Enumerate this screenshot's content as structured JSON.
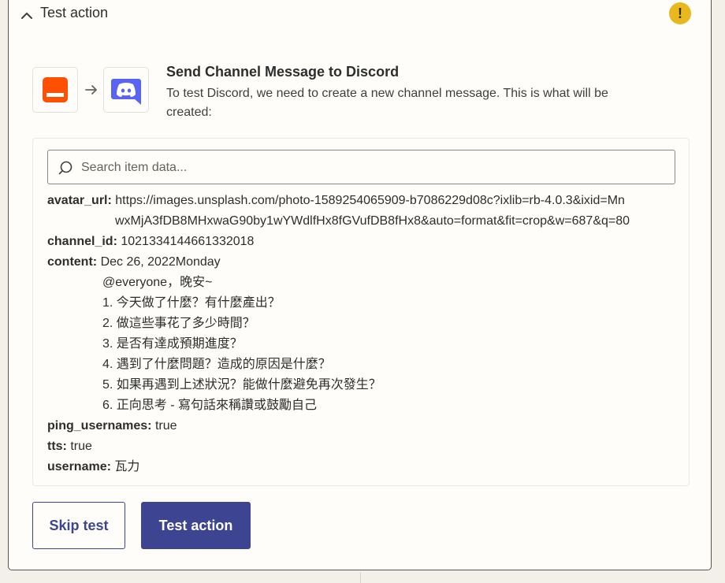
{
  "header": {
    "title": "Test action",
    "warning_symbol": "!",
    "warning_color": "#e8b81e"
  },
  "step": {
    "source_icon": "app-logo-icon",
    "target_icon": "discord-icon",
    "title": "Send Channel Message to Discord",
    "description": "To test Discord, we need to create a new channel message. This is what will be created:"
  },
  "search": {
    "placeholder": "Search item data...",
    "value": ""
  },
  "fields": {
    "avatar_url": {
      "key": "avatar_url:",
      "line1": "https://images.unsplash.com/photo-1589254065909-b7086229d08c?ixlib=rb-4.0.3&ixid=Mn",
      "line2": "wxMjA3fDB8MHxwaG90by1wYWdlfHx8fGVufDB8fHx8&auto=format&fit=crop&w=687&q=80"
    },
    "channel_id": {
      "key": "channel_id:",
      "value": "1021334144661332018"
    },
    "content": {
      "key": "content:",
      "lines": [
        "Dec 26, 2022Monday",
        "@everyone，晚安~",
        "1. 今天做了什麼？有什麼產出？",
        "2. 做這些事花了多少時間？",
        "3. 是否有達成預期進度？",
        "4. 遇到了什麼問題？造成的原因是什麼？",
        "5. 如果再遇到上述狀況？能做什麼避免再次發生？",
        "6. 正向思考 - 寫句話來稱讚或鼓勵自己"
      ]
    },
    "ping_usernames": {
      "key": "ping_usernames:",
      "value": "true"
    },
    "tts": {
      "key": "tts:",
      "value": "true"
    },
    "username": {
      "key": "username:",
      "value": "瓦力"
    }
  },
  "buttons": {
    "skip": "Skip test",
    "test": "Test action"
  },
  "colors": {
    "primary": "#3d4592",
    "source_app": "#ff4f00",
    "discord": "#5865f2"
  }
}
